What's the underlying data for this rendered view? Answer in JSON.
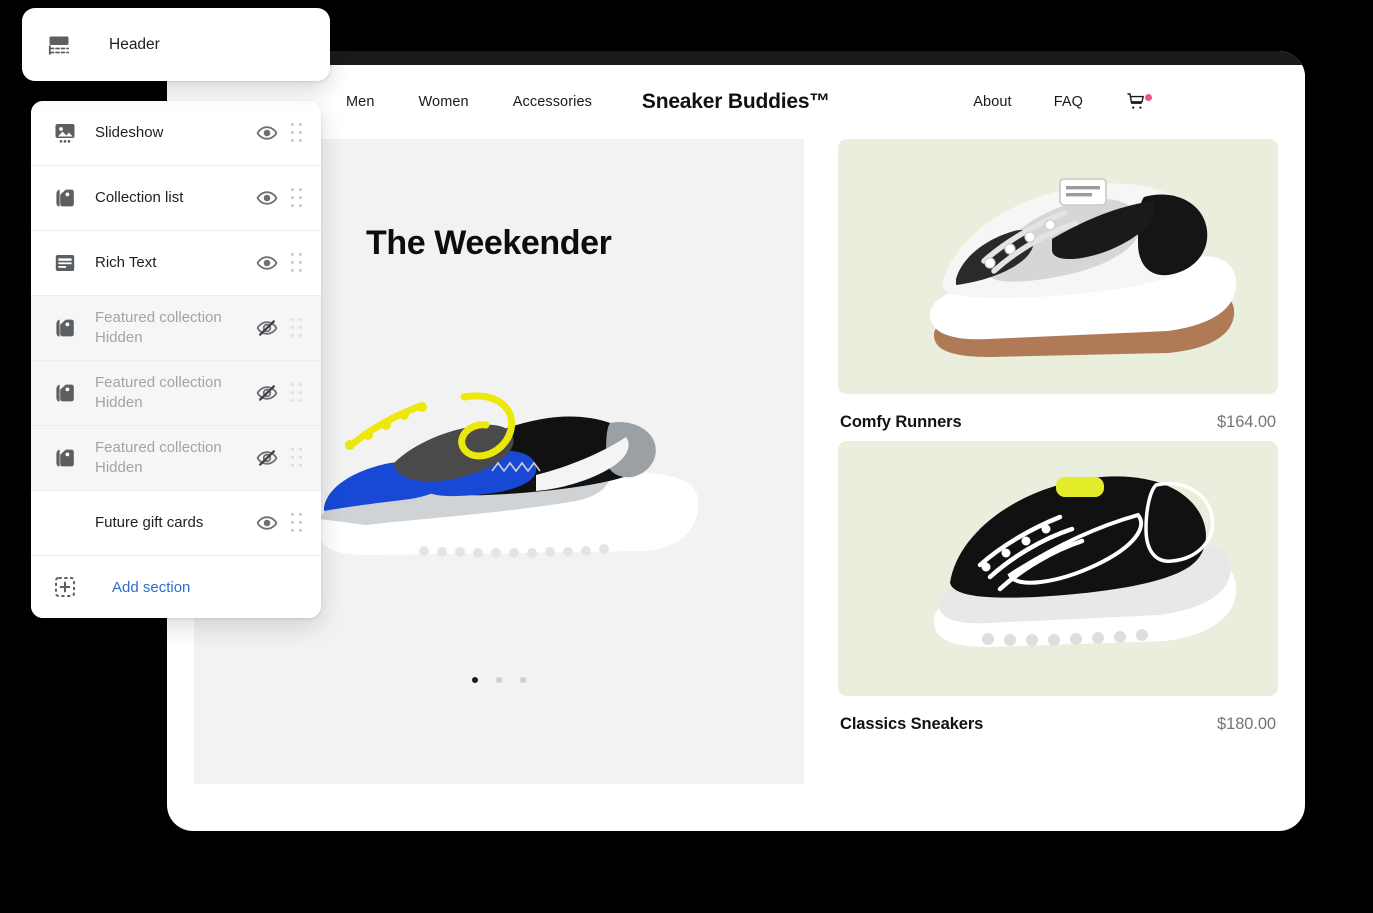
{
  "editor": {
    "header_card": {
      "label": "Header",
      "icon": "header-section-icon"
    },
    "sections_panel": {
      "items": [
        {
          "label": "Slideshow",
          "status": "",
          "icon": "slideshow-icon",
          "hidden": false,
          "visibility_icon": "eye-icon"
        },
        {
          "label": "Collection list",
          "status": "",
          "icon": "collection-tags-icon",
          "hidden": false,
          "visibility_icon": "eye-icon"
        },
        {
          "label": "Rich Text",
          "status": "",
          "icon": "rich-text-icon",
          "hidden": false,
          "visibility_icon": "eye-icon"
        },
        {
          "label": "Featured collection",
          "status": "Hidden",
          "icon": "collection-tags-icon",
          "hidden": true,
          "visibility_icon": "eye-slash-icon"
        },
        {
          "label": "Featured collection",
          "status": "Hidden",
          "icon": "collection-tags-icon",
          "hidden": true,
          "visibility_icon": "eye-slash-icon"
        },
        {
          "label": "Featured collection",
          "status": "Hidden",
          "icon": "collection-tags-icon",
          "hidden": true,
          "visibility_icon": "eye-slash-icon"
        },
        {
          "label": "Future gift cards",
          "status": "",
          "icon": "",
          "hidden": false,
          "visibility_icon": "eye-icon"
        }
      ],
      "add_section": {
        "label": "Add section",
        "icon": "add-plus-dashed-icon",
        "color": "#2c6ecb"
      }
    }
  },
  "store": {
    "nav": {
      "left_links": [
        "Men",
        "Women",
        "Accessories"
      ],
      "logo": "Sneaker Buddies™",
      "right_links": [
        "About",
        "FAQ"
      ],
      "cart_icon": "shopping-cart-icon",
      "cart_badge_color": "#e9558f"
    },
    "hero": {
      "title": "The Weekender",
      "background": "#f2f2f2",
      "image_alt": "blue-black-sneaker",
      "slides": 3,
      "active_slide": 1
    },
    "products": [
      {
        "title": "Comfy Runners",
        "price": "$164.00",
        "media_bg": "#eaeedc",
        "image_alt": "white-black-chunky-sneaker"
      },
      {
        "title": "Classics Sneakers",
        "price": "$180.00",
        "media_bg": "#eaeedc",
        "image_alt": "black-white-classic-sneaker"
      }
    ]
  }
}
